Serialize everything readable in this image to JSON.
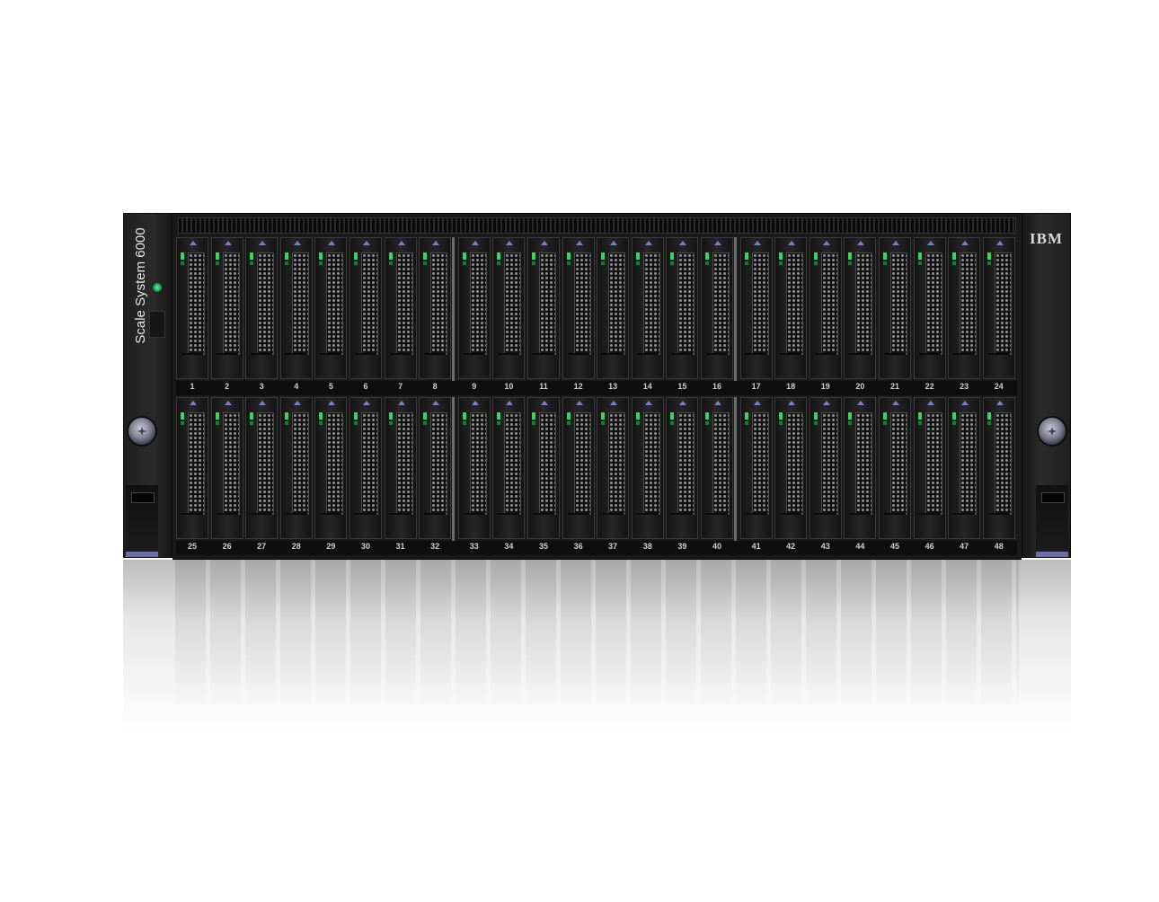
{
  "product": {
    "model_name": "Scale System 6000",
    "brand": "IBM"
  },
  "enclosure": {
    "drive_bays_top": [
      "1",
      "2",
      "3",
      "4",
      "5",
      "6",
      "7",
      "8",
      "9",
      "10",
      "11",
      "12",
      "13",
      "14",
      "15",
      "16",
      "17",
      "18",
      "19",
      "20",
      "21",
      "22",
      "23",
      "24"
    ],
    "drive_bays_bottom": [
      "25",
      "26",
      "27",
      "28",
      "29",
      "30",
      "31",
      "32",
      "33",
      "34",
      "35",
      "36",
      "37",
      "38",
      "39",
      "40",
      "41",
      "42",
      "43",
      "44",
      "45",
      "46",
      "47",
      "48"
    ],
    "led_color": "#2fdc5a",
    "accent_color": "#6e6ea6"
  }
}
